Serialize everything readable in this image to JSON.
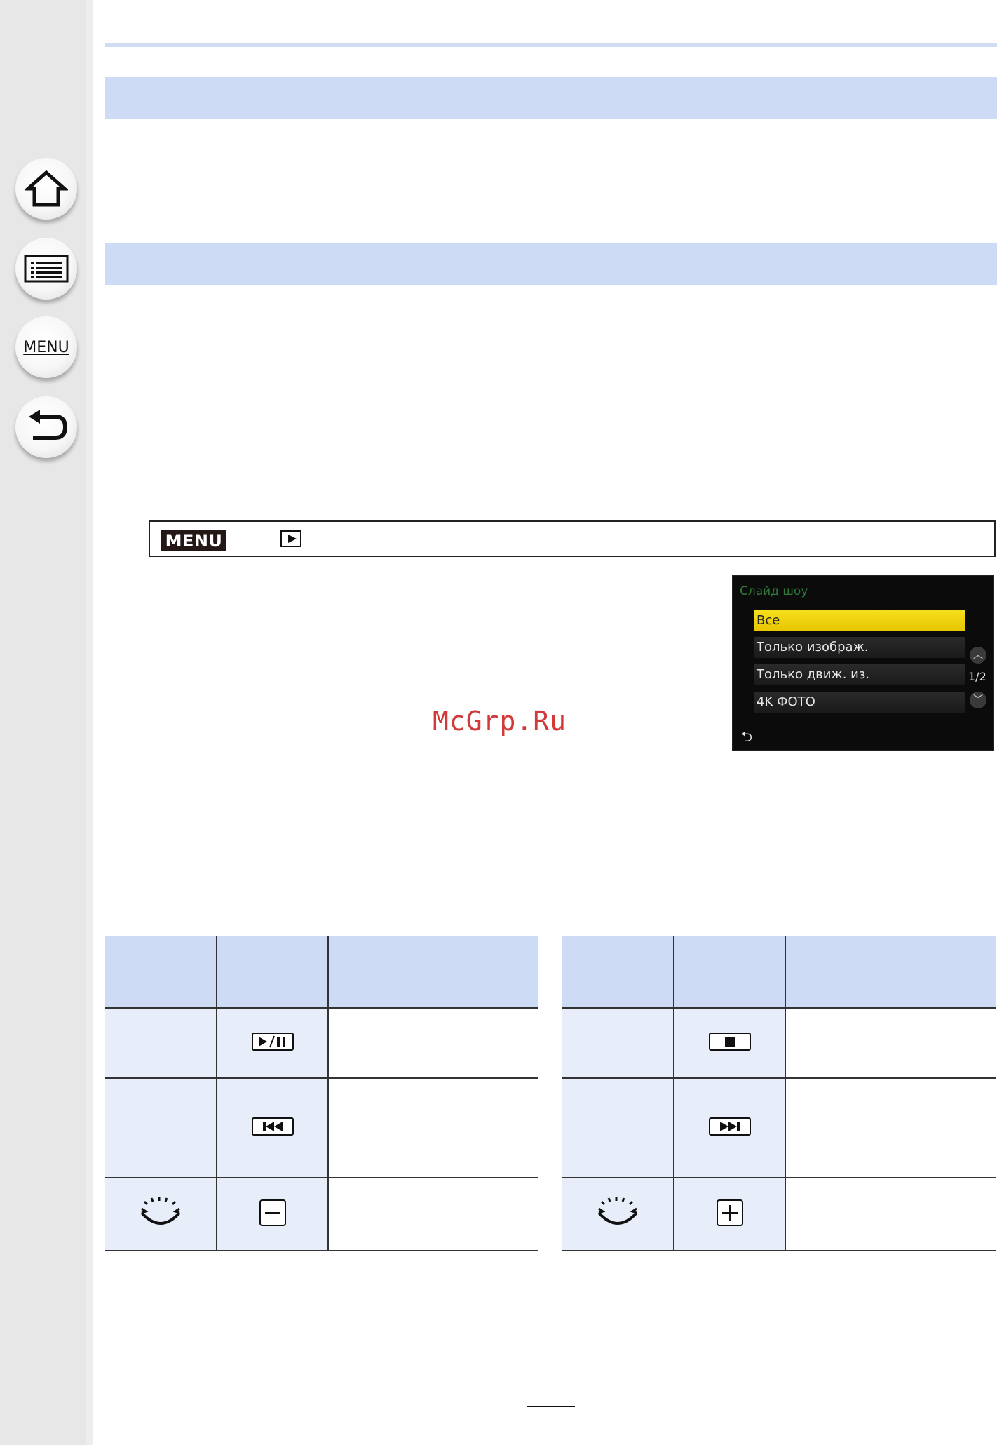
{
  "sidebar": {
    "items": [
      {
        "name": "home",
        "icon": "home-icon"
      },
      {
        "name": "contents",
        "icon": "list-icon"
      },
      {
        "name": "menu",
        "icon": "menu-icon",
        "label": "MENU"
      },
      {
        "name": "back",
        "icon": "back-icon"
      }
    ]
  },
  "menu_path": {
    "badge": "MENU",
    "icon": "playback-icon"
  },
  "camera_screen": {
    "title": "Слайд шоу",
    "items": [
      "Все",
      "Только изображ.",
      "Только движ. из.",
      "4K ФОТО"
    ],
    "selected_index": 0,
    "page_indicator": "1/2",
    "up_icon": "chevron-up-icon",
    "down_icon": "chevron-down-icon",
    "back_symbol": "⮌"
  },
  "watermark": "McGrp.Ru",
  "controls_left": [
    {
      "icon": "play-pause-icon"
    },
    {
      "icon": "previous-icon"
    },
    {
      "dial_icon": "control-dial-left-icon",
      "icon": "minus-icon"
    }
  ],
  "controls_right": [
    {
      "icon": "stop-icon"
    },
    {
      "icon": "next-icon"
    },
    {
      "dial_icon": "control-dial-right-icon",
      "icon": "plus-icon"
    }
  ],
  "colors": {
    "band": "#cddcf4",
    "cell_shade": "#e7eef9",
    "selection": "#f2d60f",
    "watermark": "#d23a3a"
  }
}
